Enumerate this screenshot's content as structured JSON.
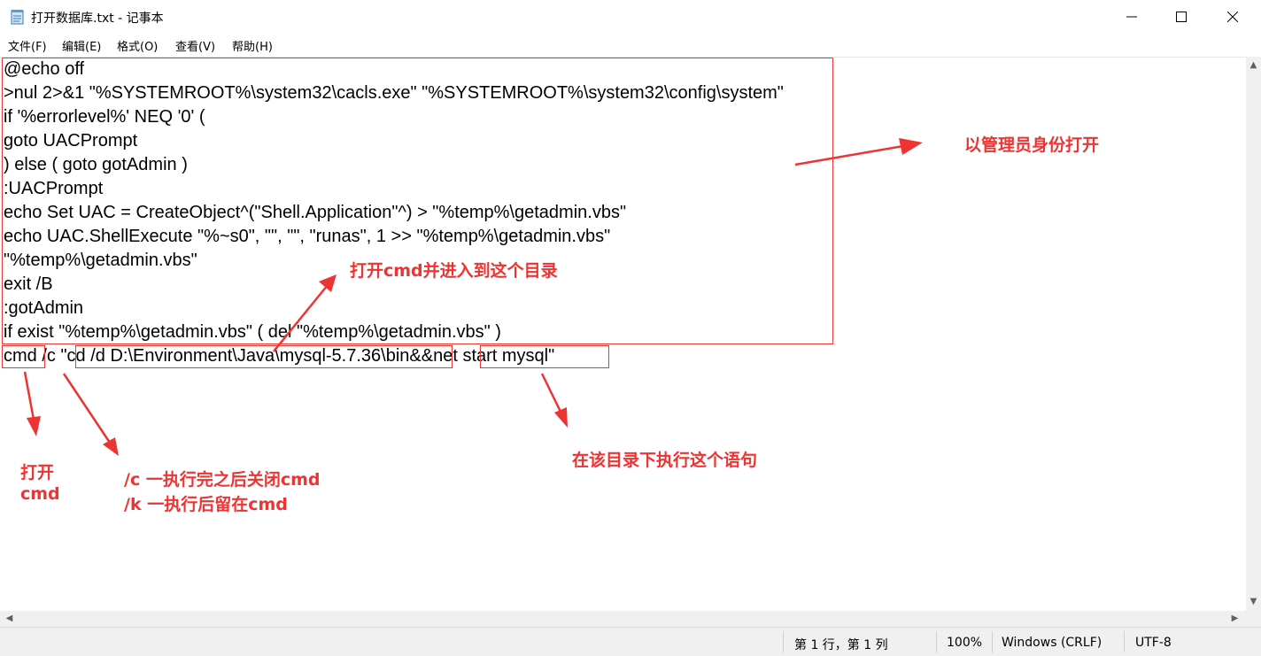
{
  "window": {
    "title": "打开数据库.txt - 记事本",
    "icon": "notepad-icon"
  },
  "menu": [
    "文件(F)",
    "编辑(E)",
    "格式(O)",
    "查看(V)",
    "帮助(H)"
  ],
  "editor": {
    "lines": [
      "@echo off",
      ">nul 2>&1 \"%SYSTEMROOT%\\system32\\cacls.exe\" \"%SYSTEMROOT%\\system32\\config\\system\"",
      "if '%errorlevel%' NEQ '0' (",
      "goto UACPrompt",
      ") else ( goto gotAdmin )",
      ":UACPrompt",
      "echo Set UAC = CreateObject^(\"Shell.Application\"^) > \"%temp%\\getadmin.vbs\"",
      "echo UAC.ShellExecute \"%~s0\", \"\", \"\", \"runas\", 1 >> \"%temp%\\getadmin.vbs\"",
      "\"%temp%\\getadmin.vbs\"",
      "exit /B",
      ":gotAdmin",
      "if exist \"%temp%\\getadmin.vbs\" ( del \"%temp%\\getadmin.vbs\" )",
      "cmd /c \"cd /d D:\\Environment\\Java\\mysql-5.7.36\\bin&&net start mysql\""
    ]
  },
  "annotations": {
    "admin": "以管理员身份打开",
    "cd_dir": "打开cmd并进入到这个目录",
    "open_cmd_1": "打开",
    "open_cmd_2": "cmd",
    "c_flag": "/c  一执行完之后关闭cmd",
    "k_flag": "/k 一执行后留在cmd",
    "run_here": "在该目录下执行这个语句"
  },
  "status": {
    "position": "第 1 行，第 1 列",
    "zoom": "100%",
    "line_ending": "Windows (CRLF)",
    "encoding": "UTF-8"
  },
  "colors": {
    "annotation": "#e53935"
  }
}
